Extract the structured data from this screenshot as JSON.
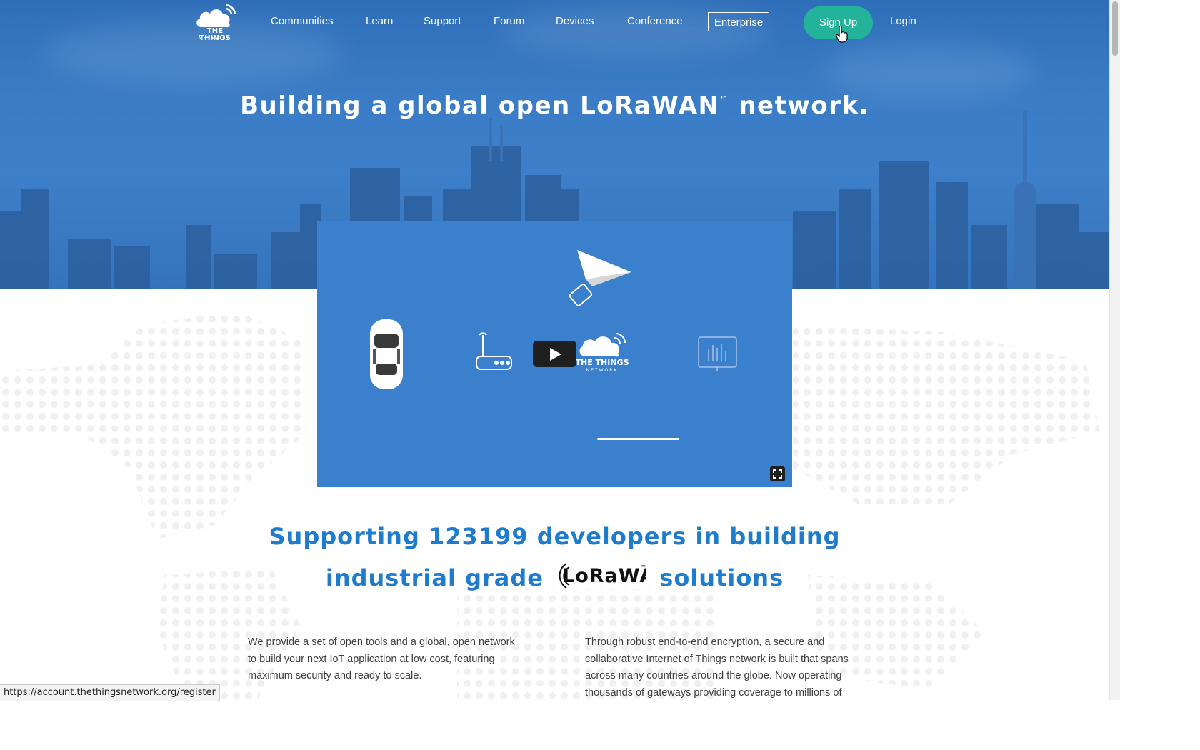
{
  "nav": {
    "logo_line1": "THE THINGS",
    "logo_line2": "NETWORK",
    "links": [
      "Communities",
      "Learn",
      "Support",
      "Forum",
      "Devices",
      "Conference"
    ],
    "enterprise_label": "Enterprise",
    "signup_label": "Sign Up",
    "login_label": "Login"
  },
  "hero": {
    "title": "Building a global open LoRaWAN",
    "title_tm": "™",
    "title_end": " network."
  },
  "video": {
    "logo_line1": "THE THINGS",
    "logo_line2": "NETWORK"
  },
  "support": {
    "line1": "Supporting 123199 developers in building",
    "line2_before": "industrial grade",
    "line2_after": "solutions",
    "lorawan_logo_text": "LoRaWAN",
    "lorawan_tm": "™"
  },
  "columns": {
    "left": "We provide a set of open tools and a global, open network to build your next IoT application at low cost, featuring maximum security and ready to scale.",
    "right": "Through robust end-to-end encryption, a secure and collaborative Internet of Things network is built that spans across many countries around the globe. Now operating thousands of gateways providing coverage to millions of"
  },
  "statusbar": {
    "url": "https://account.thethingsnetwork.org/register"
  },
  "colors": {
    "hero_blue": "#3b80cc",
    "headline_blue": "#1f7ccc",
    "signup_green": "#23b39a"
  }
}
